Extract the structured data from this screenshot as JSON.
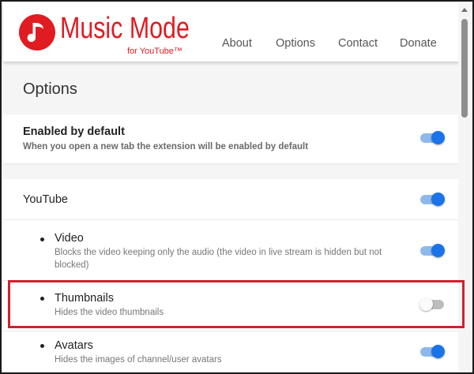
{
  "header": {
    "logo_title": "Music Mode",
    "logo_subtitle": "for YouTube™",
    "nav": [
      "About",
      "Options",
      "Contact",
      "Donate"
    ]
  },
  "page": {
    "title": "Options"
  },
  "settings": {
    "enabled_by_default": {
      "title": "Enabled by default",
      "description": "When you open a new tab the extension will be enabled by default",
      "on": true
    },
    "youtube": {
      "title": "YouTube",
      "on": true,
      "items": [
        {
          "title": "Video",
          "description": "Blocks the video keeping only the audio (the video in live stream is hidden but not blocked)",
          "on": true
        },
        {
          "title": "Thumbnails",
          "description": "Hides the video thumbnails",
          "on": false
        },
        {
          "title": "Avatars",
          "description": "Hides the images of channel/user avatars",
          "on": true
        }
      ]
    }
  },
  "colors": {
    "brand_red": "#e01b22",
    "toggle_on": "#1a73e8",
    "highlight_border": "#d0202e"
  }
}
